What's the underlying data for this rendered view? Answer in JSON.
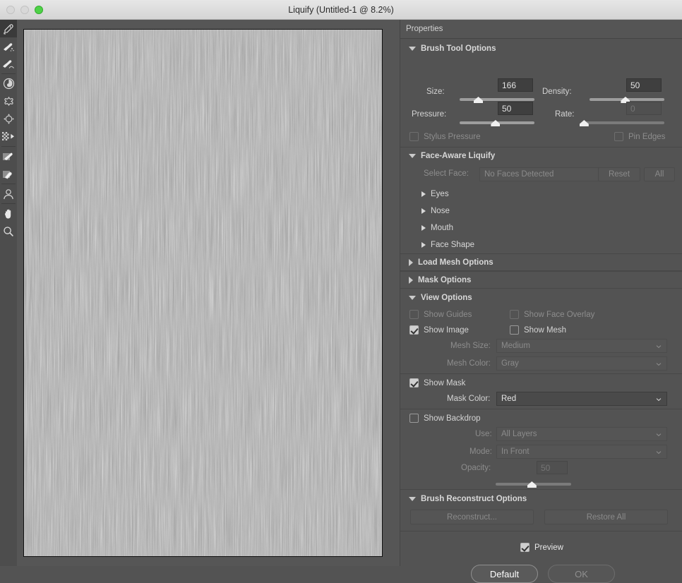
{
  "window": {
    "title": "Liquify (Untitled-1 @ 8.2%)",
    "traffic": {
      "close": "close-button",
      "minimize": "minimize-button",
      "zoom": "zoom-button"
    }
  },
  "toolbar": {
    "tools": [
      {
        "name": "forward-warp-tool",
        "selected": true
      },
      {
        "name": "reconstruct-tool",
        "selected": false
      },
      {
        "name": "smooth-tool",
        "selected": false
      },
      {
        "name": "twirl-clockwise-tool",
        "selected": false
      },
      {
        "name": "pucker-tool",
        "selected": false
      },
      {
        "name": "bloat-tool",
        "selected": false
      },
      {
        "name": "push-left-tool",
        "selected": false
      },
      {
        "name": "freeze-mask-tool",
        "selected": false
      },
      {
        "name": "thaw-mask-tool",
        "selected": false
      },
      {
        "name": "face-tool",
        "selected": false
      },
      {
        "name": "hand-tool",
        "selected": false
      },
      {
        "name": "zoom-tool",
        "selected": false
      }
    ]
  },
  "panel": {
    "header": "Properties"
  },
  "brush_tool_options": {
    "title": "Brush Tool Options",
    "size": {
      "label": "Size:",
      "value": "166",
      "slider_pct": 25,
      "enabled": true
    },
    "density": {
      "label": "Density:",
      "value": "50",
      "slider_pct": 48,
      "enabled": true
    },
    "pressure": {
      "label": "Pressure:",
      "value": "50",
      "slider_pct": 48,
      "enabled": true
    },
    "rate": {
      "label": "Rate:",
      "value": "0",
      "slider_pct": 2,
      "enabled": false
    },
    "stylus_pressure": {
      "label": "Stylus Pressure",
      "checked": false,
      "enabled": false
    },
    "pin_edges": {
      "label": "Pin Edges",
      "checked": false,
      "enabled": false
    }
  },
  "face_aware_liquify": {
    "title": "Face-Aware Liquify",
    "select_face_label": "Select Face:",
    "select_face_value": "No Faces Detected",
    "reset_label": "Reset",
    "all_label": "All",
    "subsections": [
      {
        "label": "Eyes"
      },
      {
        "label": "Nose"
      },
      {
        "label": "Mouth"
      },
      {
        "label": "Face Shape"
      }
    ]
  },
  "load_mesh_options": {
    "title": "Load Mesh Options"
  },
  "mask_options": {
    "title": "Mask Options"
  },
  "view_options": {
    "title": "View Options",
    "show_guides": {
      "label": "Show Guides",
      "checked": false,
      "enabled": false
    },
    "show_face_overlay": {
      "label": "Show Face Overlay",
      "checked": false,
      "enabled": false
    },
    "show_image": {
      "label": "Show Image",
      "checked": true,
      "enabled": true
    },
    "show_mesh": {
      "label": "Show Mesh",
      "checked": false,
      "enabled": true
    },
    "mesh_size": {
      "label": "Mesh Size:",
      "value": "Medium",
      "enabled": false
    },
    "mesh_color": {
      "label": "Mesh Color:",
      "value": "Gray",
      "enabled": false
    },
    "show_mask": {
      "label": "Show Mask",
      "checked": true,
      "enabled": true
    },
    "mask_color": {
      "label": "Mask Color:",
      "value": "Red",
      "enabled": true
    },
    "show_backdrop": {
      "label": "Show Backdrop",
      "checked": false,
      "enabled": true
    },
    "use": {
      "label": "Use:",
      "value": "All Layers",
      "enabled": false
    },
    "mode": {
      "label": "Mode:",
      "value": "In Front",
      "enabled": false
    },
    "opacity": {
      "label": "Opacity:",
      "value": "50",
      "slider_pct": 48,
      "enabled": false
    }
  },
  "brush_reconstruct_options": {
    "title": "Brush Reconstruct Options",
    "reconstruct_label": "Reconstruct...",
    "restore_all_label": "Restore All"
  },
  "footer": {
    "preview": {
      "label": "Preview",
      "checked": true
    },
    "default_label": "Default",
    "ok_label": "OK"
  },
  "colors": {
    "panel_bg": "#535353",
    "canvas_bg": "#565656",
    "toolstrip_bg": "#4d4d4d",
    "text": "#d4d4d4",
    "text_dim": "#8d8d8d",
    "accent_green": "#4ed247"
  }
}
